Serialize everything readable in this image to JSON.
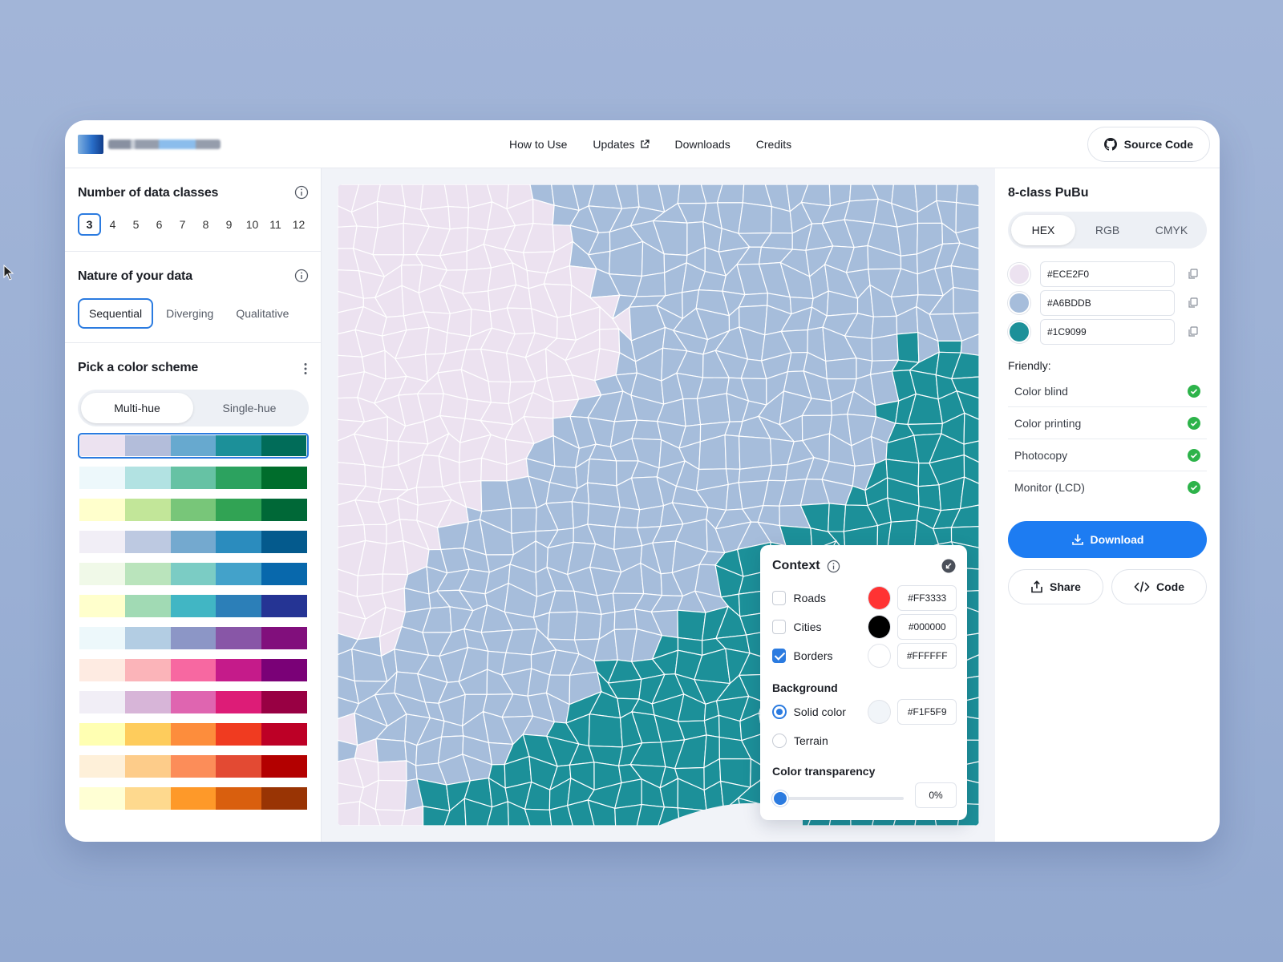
{
  "header": {
    "nav": [
      {
        "label": "How to Use",
        "external": false
      },
      {
        "label": "Updates",
        "external": true
      },
      {
        "label": "Downloads",
        "external": false
      },
      {
        "label": "Credits",
        "external": false
      }
    ],
    "source_code_label": "Source Code"
  },
  "left": {
    "classes_title": "Number of data classes",
    "classes": [
      "3",
      "4",
      "5",
      "6",
      "7",
      "8",
      "9",
      "10",
      "11",
      "12"
    ],
    "selected_class": "3",
    "nature_title": "Nature of your data",
    "nature_options": [
      "Sequential",
      "Diverging",
      "Qualitative"
    ],
    "selected_nature": "Sequential",
    "scheme_title": "Pick a color scheme",
    "hue_options": [
      "Multi-hue",
      "Single-hue"
    ],
    "selected_hue": "Multi-hue",
    "schemes": [
      [
        "#ECE2F0",
        "#B3BDDA",
        "#67A9CF",
        "#1C9099",
        "#016C59"
      ],
      [
        "#EDF8FB",
        "#B2E2E2",
        "#66C2A4",
        "#2CA25F",
        "#006D2C"
      ],
      [
        "#FFFFCC",
        "#C2E699",
        "#78C679",
        "#31A354",
        "#006837"
      ],
      [
        "#F1EEF6",
        "#BDC9E1",
        "#74A9CF",
        "#2B8CBE",
        "#045A8D"
      ],
      [
        "#F0F9E8",
        "#BAE4BC",
        "#7BCCC4",
        "#43A2CA",
        "#0868AC"
      ],
      [
        "#FFFFCC",
        "#A1DAB4",
        "#41B6C4",
        "#2C7FB8",
        "#253494"
      ],
      [
        "#EDF8FB",
        "#B3CDE3",
        "#8C96C6",
        "#8856A7",
        "#810F7C"
      ],
      [
        "#FEEBE2",
        "#FBB4B9",
        "#F768A1",
        "#C51B8A",
        "#7A0177"
      ],
      [
        "#F1EEF6",
        "#D7B5D8",
        "#DF65B0",
        "#DD1C77",
        "#980043"
      ],
      [
        "#FFFFB2",
        "#FECC5C",
        "#FD8D3C",
        "#F03B20",
        "#BD0026"
      ],
      [
        "#FEF0D9",
        "#FDCC8A",
        "#FC8D59",
        "#E34A33",
        "#B30000"
      ],
      [
        "#FFFFD4",
        "#FED98E",
        "#FE9929",
        "#D95F0E",
        "#993404"
      ]
    ]
  },
  "map": {
    "class_colors": [
      "#ECE2F0",
      "#A6BDDB",
      "#1C9099"
    ],
    "context": {
      "title": "Context",
      "layers": [
        {
          "label": "Roads",
          "checked": false,
          "color": "#FF3333",
          "hex": "#FF3333"
        },
        {
          "label": "Cities",
          "checked": false,
          "color": "#000000",
          "hex": "#000000"
        },
        {
          "label": "Borders",
          "checked": true,
          "color": "#FFFFFF",
          "hex": "#FFFFFF"
        }
      ],
      "background_title": "Background",
      "background_options": [
        {
          "label": "Solid color",
          "selected": true,
          "color": "#F1F5F9",
          "hex": "#F1F5F9"
        },
        {
          "label": "Terrain",
          "selected": false
        }
      ],
      "transparency_title": "Color transparency",
      "transparency_value": "0%",
      "transparency_fraction": 0
    }
  },
  "right": {
    "title": "8-class PuBu",
    "formats": [
      "HEX",
      "RGB",
      "CMYK"
    ],
    "selected_format": "HEX",
    "colors": [
      {
        "hex": "#ECE2F0",
        "color": "#ECE2F0"
      },
      {
        "hex": "#A6BDDB",
        "color": "#A6BDDB"
      },
      {
        "hex": "#1C9099",
        "color": "#1C9099"
      }
    ],
    "friendly_label": "Friendly:",
    "friendly": [
      "Color blind",
      "Color printing",
      "Photocopy",
      "Monitor (LCD)"
    ],
    "download_label": "Download",
    "share_label": "Share",
    "code_label": "Code"
  },
  "colors": {
    "accent": "#2B7BE0",
    "primary_button": "#1D7CF2",
    "check_green": "#2DB34A",
    "map_background": "#F1F3F8"
  }
}
